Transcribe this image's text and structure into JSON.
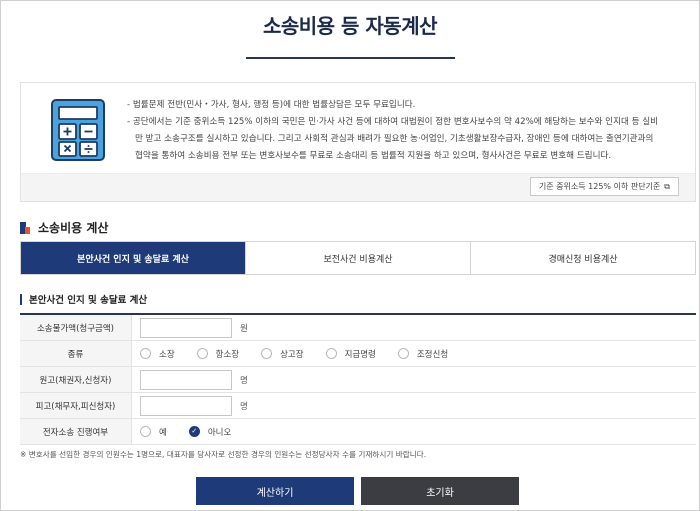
{
  "header": {
    "title": "소송비용 등 자동계산"
  },
  "notice": {
    "lines": [
      "- 법률문제 전반(민사・가사, 형사, 행정 등)에 대한 법률상담은 모두 무료입니다.",
      "- 공단에서는 기준 중위소득 125% 이하의 국민은 민·가사 사건 등에 대하여 대법원이 정한 변호사보수의 약 42%에 해당하는 보수와 인지대 등 실비",
      "만 받고 소송구조를 실시하고 있습니다. 그리고 사회적 관심과 배려가 필요한 농·어업인, 기초생활보장수급자, 장애인 등에 대하여는 출연기관과의",
      "협약을 통하여 소송비용 전부 또는 변호사보수를 무료로 소송대리 등 법률적 지원을 하고 있으며, 형사사건은 무료로 변호해 드립니다."
    ],
    "criteria_link": "기준 중위소득 125% 이하 판단기준",
    "icon": "calculator-icon"
  },
  "section": {
    "title": "소송비용 계산"
  },
  "tabs": [
    {
      "label": "본안사건 인지 및 송달료 계산",
      "active": true
    },
    {
      "label": "보전사건 비용계산",
      "active": false
    },
    {
      "label": "경매신청 비용계산",
      "active": false
    }
  ],
  "form": {
    "title": "본안사건 인지 및 송달료 계산",
    "amount": {
      "label": "소송물가액(청구금액)",
      "value": "",
      "unit": "원"
    },
    "type": {
      "label": "종류",
      "options": [
        "소장",
        "항소장",
        "상고장",
        "지급명령",
        "조정신청"
      ],
      "selected": ""
    },
    "plaintiff": {
      "label": "원고(채권자,신청자)",
      "value": "",
      "unit": "명"
    },
    "defendant": {
      "label": "피고(채무자,피신청자)",
      "value": "",
      "unit": "명"
    },
    "electronic": {
      "label": "전자소송 진행여부",
      "options": [
        "예",
        "아니오"
      ],
      "selected": "아니오"
    }
  },
  "note": "※ 변호사를 선임한 경우의 인원수는 1명으로, 대표자를 당사자로 선정한 경우의 인원수는 선정당사자 수를 기재하시기 바랍니다.",
  "buttons": {
    "calculate": "계산하기",
    "reset": "초기화"
  },
  "colors": {
    "primary": "#1e3a78",
    "dark": "#3b3d42",
    "accent": "#e4542b",
    "icon_blue": "#4aa3dd"
  }
}
